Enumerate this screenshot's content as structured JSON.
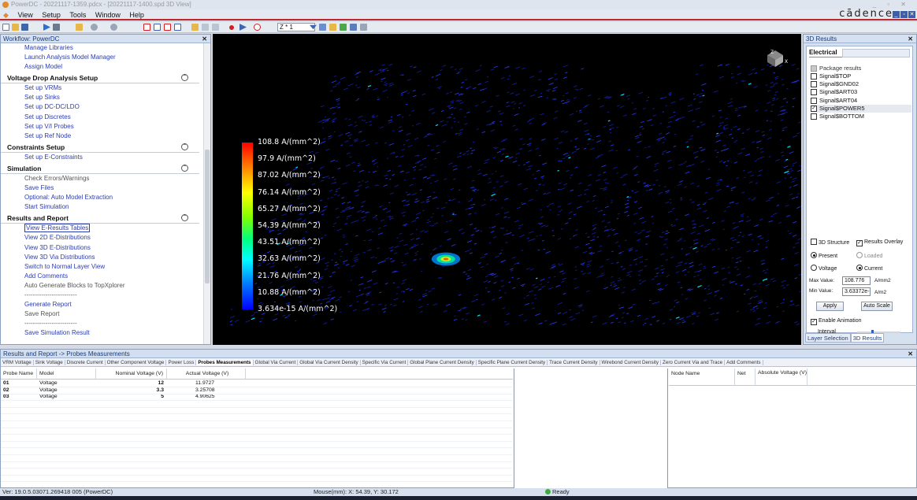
{
  "window": {
    "title": "PowerDC - 20221117-1359.pdcx - [20221117-1400.spd 3D View]",
    "brand": "cādence"
  },
  "menu": [
    "View",
    "Setup",
    "Tools",
    "Window",
    "Help"
  ],
  "toolbar": {
    "zoom_combo": "Z * 1"
  },
  "workflow": {
    "title": "Workflow: PowerDC",
    "items": [
      {
        "type": "link",
        "label": "Manage Libraries"
      },
      {
        "type": "link",
        "label": "Launch Analysis Model Manager"
      },
      {
        "type": "link",
        "label": "Assign Model"
      },
      {
        "type": "section",
        "label": "Voltage Drop Analysis Setup"
      },
      {
        "type": "link",
        "label": "Set up VRMs"
      },
      {
        "type": "link",
        "label": "Set up Sinks"
      },
      {
        "type": "link",
        "label": "Set up DC-DC/LDO"
      },
      {
        "type": "link",
        "label": "Set up Discretes"
      },
      {
        "type": "link",
        "label": "Set up V/I Probes"
      },
      {
        "type": "link",
        "label": "Set up Ref Node"
      },
      {
        "type": "section",
        "label": "Constraints Setup"
      },
      {
        "type": "link",
        "label": "Set up E-Constraints"
      },
      {
        "type": "section",
        "label": "Simulation"
      },
      {
        "type": "gray",
        "label": "Check Errors/Warnings"
      },
      {
        "type": "link",
        "label": "Save Files"
      },
      {
        "type": "link",
        "label": "Optional: Auto Model Extraction"
      },
      {
        "type": "link",
        "label": "Start Simulation"
      },
      {
        "type": "section",
        "label": "Results and Report"
      },
      {
        "type": "boxed",
        "label": "View E-Results Tables"
      },
      {
        "type": "link",
        "label": "View 2D E-Distributions"
      },
      {
        "type": "link",
        "label": "View 3D E-Distributions"
      },
      {
        "type": "link",
        "label": "View 3D Via Distributions"
      },
      {
        "type": "link",
        "label": "Switch to Normal Layer View"
      },
      {
        "type": "link",
        "label": "Add Comments"
      },
      {
        "type": "gray",
        "label": "Auto Generate Blocks to TopXplorer"
      },
      {
        "type": "gray",
        "label": "-------------------------"
      },
      {
        "type": "link",
        "label": "Generate Report"
      },
      {
        "type": "gray",
        "label": "Save Report"
      },
      {
        "type": "gray",
        "label": "-------------------------"
      },
      {
        "type": "link",
        "label": "Save Simulation Result"
      }
    ]
  },
  "legend": {
    "labels": [
      "108.8 A/(mm^2)",
      "97.9 A/(mm^2)",
      "87.02 A/(mm^2)",
      "76.14 A/(mm^2)",
      "65.27 A/(mm^2)",
      "54.39 A/(mm^2)",
      "43.51 A/(mm^2)",
      "32.63 A/(mm^2)",
      "21.76 A/(mm^2)",
      "10.88 A/(mm^2)",
      "3.634e-15 A/(mm^2)"
    ],
    "axes": {
      "z": "Z",
      "x": "X"
    }
  },
  "results3d": {
    "title": "3D Results",
    "tab": "Electrical",
    "package_results": "Package results",
    "layers": [
      {
        "name": "Signal$TOP",
        "checked": false
      },
      {
        "name": "Signal$GND02",
        "checked": false
      },
      {
        "name": "Signal$ART03",
        "checked": false
      },
      {
        "name": "Signal$ART04",
        "checked": false
      },
      {
        "name": "Signal$POWER5",
        "checked": true
      },
      {
        "name": "Signal$BOTTOM",
        "checked": false
      }
    ],
    "structure_3d": "3D Structure",
    "results_overlay": "Results Overlay",
    "present": "Present",
    "loaded": "Loaded",
    "voltage": "Voltage",
    "current": "Current",
    "max_label": "Max Value:",
    "max_value": "108.776",
    "max_unit": "A/mm2",
    "min_label": "Min Value:",
    "min_value": "3.63372e-",
    "min_unit": "A/m2",
    "apply": "Apply",
    "auto_scale": "Auto Scale",
    "enable_animation": "Enable Animation",
    "interval": "Interval",
    "tabs": [
      "Layer Selection",
      "3D Results"
    ]
  },
  "bottom": {
    "title": "Results and Report -> Probes Measurements",
    "tabs": [
      "VRM Voltage",
      "Sink Voltage",
      "Discrete Current",
      "Other Component Voltage",
      "Power Loss",
      "Probes Measurements",
      "Global Via Current",
      "Global Via Current Density",
      "Specific Via Current",
      "Global Plane Current Density",
      "Specific Plane Current Density",
      "Trace Current Density",
      "Wirebond Current Density",
      "Zero Current Via and Trace",
      "Add Comments"
    ],
    "active_tab": "Probes Measurements",
    "columns": [
      "Probe Name",
      "Model",
      "Nominal Voltage (V)",
      "Actual Voltage (V)"
    ],
    "rows": [
      {
        "probe": "01",
        "model": "Voltage",
        "nominal": "12",
        "actual": "11.9727"
      },
      {
        "probe": "02",
        "model": "Voltage",
        "nominal": "3.3",
        "actual": "3.25708"
      },
      {
        "probe": "03",
        "model": "Voltage",
        "nominal": "5",
        "actual": "4.90625"
      }
    ],
    "right_columns": [
      "Node Name",
      "Net",
      "Absolute Voltage (V)"
    ]
  },
  "status": {
    "version": "Ver: 19.0.5.03071.269418  005 (PowerDC)",
    "mouse": "Mouse(mm): X: 54.39, Y: 30.172",
    "ready": "Ready"
  }
}
